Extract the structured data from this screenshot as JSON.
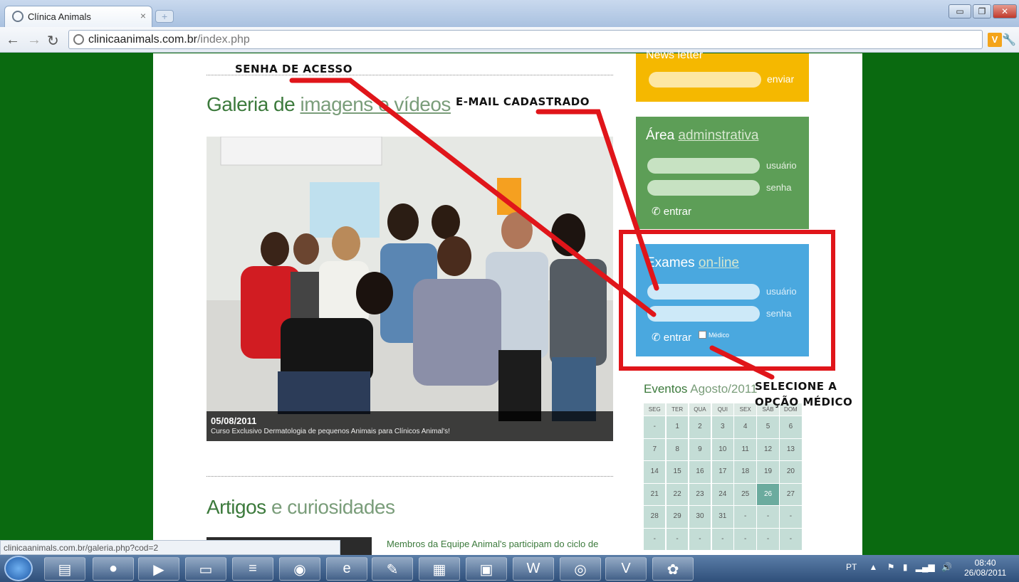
{
  "browser": {
    "tab_title": "Clínica Animals",
    "tab_close": "×",
    "url_domain": "clinicaanimals.com.br",
    "url_path": "/index.php",
    "window_buttons": [
      "▭",
      "❐",
      "✕"
    ]
  },
  "page": {
    "news_title": "News letter",
    "news_send": "enviar",
    "galeria_title_bold": "Galeria de",
    "galeria_title_light": "imagens e vídeos",
    "photo_date": "05/08/2011",
    "photo_caption": "Curso Exclusivo Dermatologia de pequenos Animais para Clínicos Animal's!",
    "artigos_bold": "Artigos",
    "artigos_light": "e curiosidades",
    "article_link": "Membros da Equipe Animal's participam do ciclo de"
  },
  "admin": {
    "title_bold": "Área",
    "title_light": "adminstrativa",
    "user_label": "usuário",
    "pass_label": "senha",
    "enter": "entrar"
  },
  "exams": {
    "title_bold": "Exames",
    "title_light": "on-line",
    "user_label": "usuário",
    "pass_label": "senha",
    "enter": "entrar",
    "medico_label": "Médico"
  },
  "calendar": {
    "title_bold": "Eventos",
    "title_light": "Agosto/2011",
    "headers": [
      "SEG",
      "TER",
      "QUA",
      "QUI",
      "SEX",
      "SÁB",
      "DOM"
    ],
    "weeks": [
      [
        "-",
        "1",
        "2",
        "3",
        "4",
        "5",
        "6"
      ],
      [
        "7",
        "8",
        "9",
        "10",
        "11",
        "12",
        "13"
      ],
      [
        "14",
        "15",
        "16",
        "17",
        "18",
        "19",
        "20"
      ],
      [
        "21",
        "22",
        "23",
        "24",
        "25",
        "26",
        "27"
      ],
      [
        "28",
        "29",
        "30",
        "31",
        "-",
        "-",
        "-"
      ],
      [
        "-",
        "-",
        "-",
        "-",
        "-",
        "-",
        "-"
      ]
    ],
    "today": "26"
  },
  "annotations": {
    "senha": "SENHA DE ACESSO",
    "email": "E-MAIL CADASTRADO",
    "selecione_1": "SELECIONE A",
    "selecione_2": "OPÇÃO MÉDICO"
  },
  "status_url": "clinicaanimals.com.br/galeria.php?cod=2",
  "taskbar": {
    "lang": "PT",
    "time": "08:40",
    "date": "26/08/2011"
  },
  "colors": {
    "background_green": "#0a6a10",
    "news_yellow": "#f5b800",
    "admin_green": "#5d9e57",
    "exam_blue": "#4aa8df",
    "annotation_red": "#e0151a"
  }
}
